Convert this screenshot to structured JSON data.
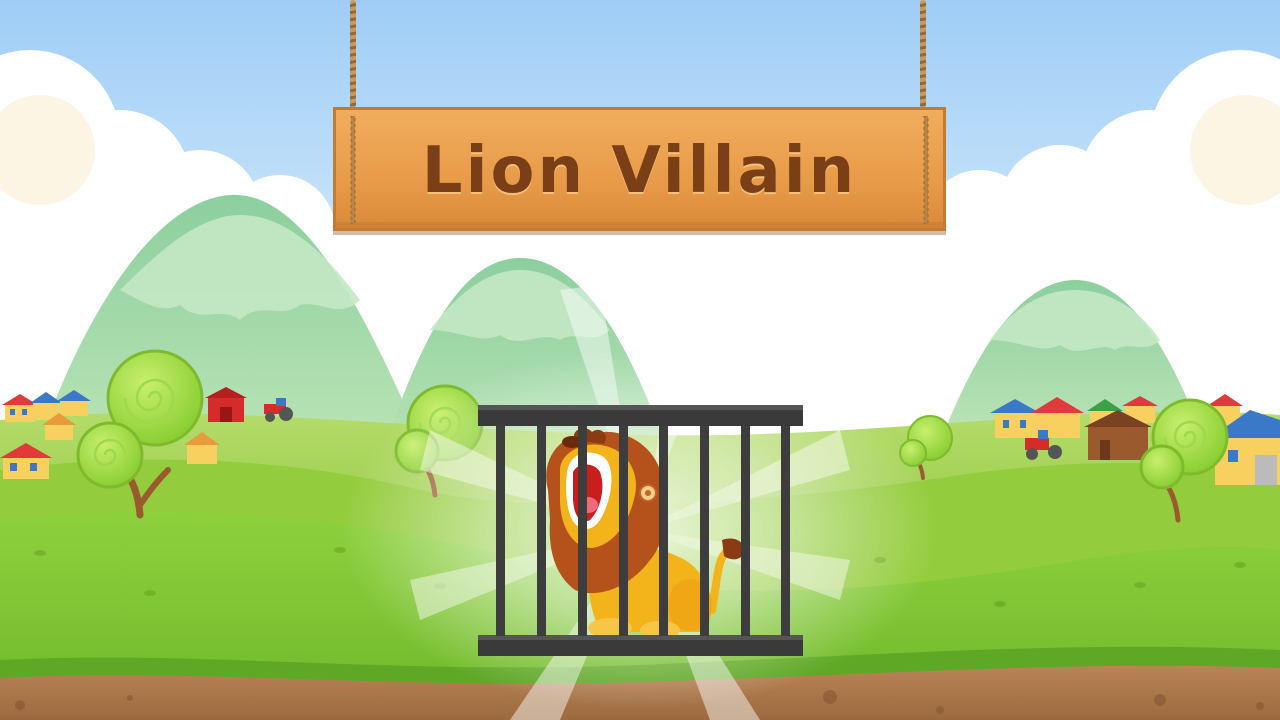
{
  "game": {
    "title": "Lion Villain",
    "scene": "lion-in-cage",
    "colors": {
      "sky": "#a8d4f5",
      "grass": "#7cc230",
      "dirt": "#a5744a",
      "sign_wood": "#e89b48",
      "sign_text": "#7a3f16",
      "cage": "#3d3d3d",
      "lion_body": "#f2b31b",
      "lion_mane": "#b5521b"
    },
    "icons": [
      "tree-icon",
      "house-icon",
      "tractor-icon",
      "barn-icon",
      "lion-icon",
      "cage-icon"
    ]
  }
}
